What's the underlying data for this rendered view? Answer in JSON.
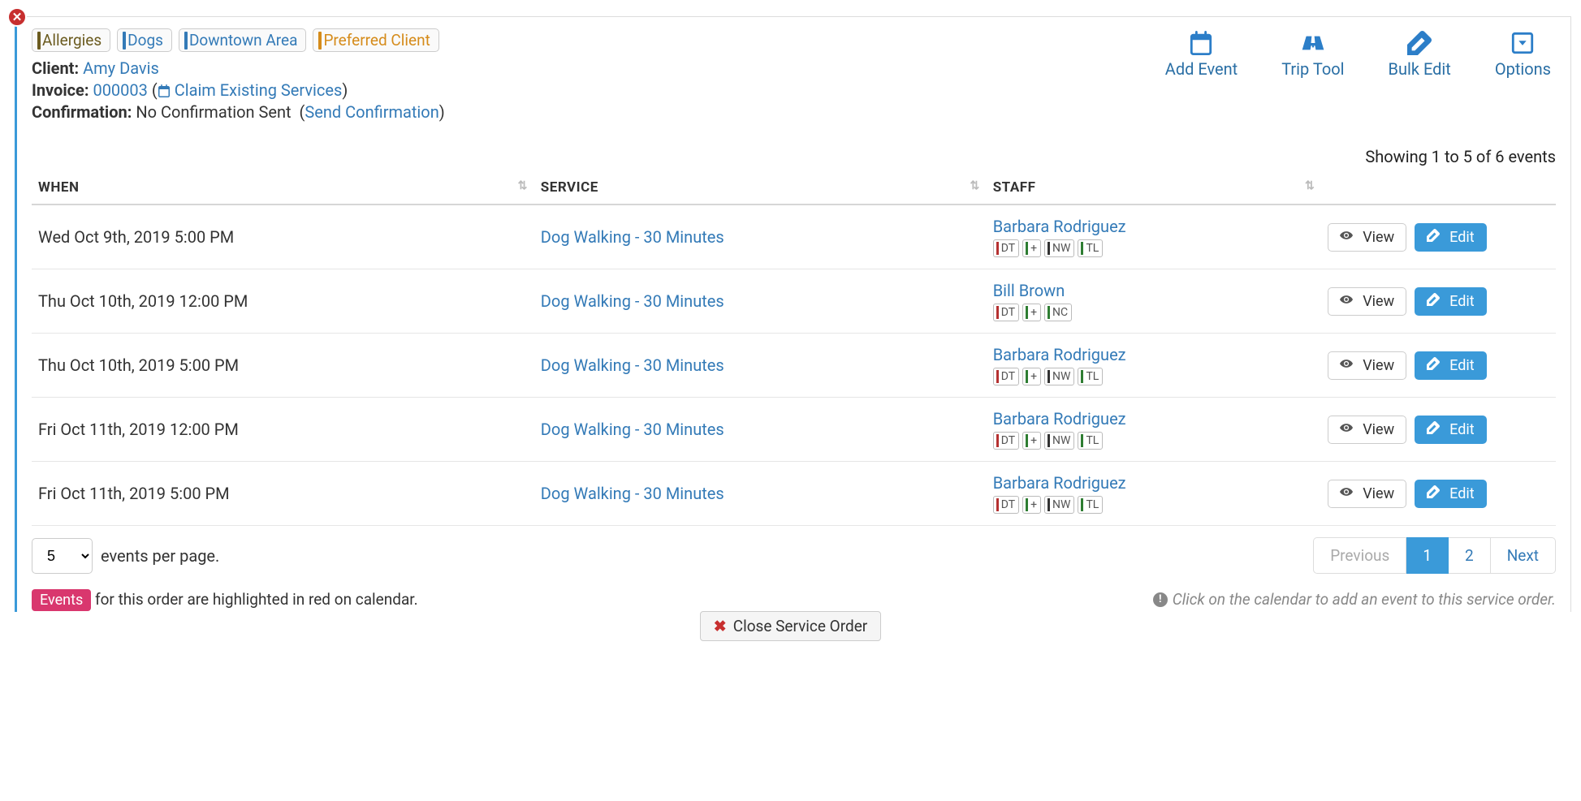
{
  "tags": [
    {
      "label": "Allergies",
      "color": "#6b5b1f"
    },
    {
      "label": "Dogs",
      "color": "#337ab7"
    },
    {
      "label": "Downtown Area",
      "color": "#337ab7"
    },
    {
      "label": "Preferred Client",
      "color": "#d58b1a"
    }
  ],
  "actions": {
    "add_event": "Add Event",
    "trip_tool": "Trip Tool",
    "bulk_edit": "Bulk Edit",
    "options": "Options"
  },
  "info": {
    "client_label": "Client:",
    "client_name": "Amy Davis",
    "invoice_label": "Invoice:",
    "invoice_number": "000003",
    "claim_link": "Claim Existing Services",
    "confirmation_label": "Confirmation:",
    "confirmation_status": "No Confirmation Sent",
    "send_confirmation": "Send Confirmation"
  },
  "showing": "Showing 1 to 5 of 6 events",
  "columns": {
    "when": "WHEN",
    "service": "SERVICE",
    "staff": "STAFF"
  },
  "territories": {
    "DT": {
      "code": "DT",
      "color": "#b53131"
    },
    "PLUS": {
      "code": "+",
      "color": "#2e7d32"
    },
    "NW": {
      "code": "NW",
      "color": "#333"
    },
    "TL": {
      "code": "TL",
      "color": "#2e7d32"
    },
    "NC": {
      "code": "NC",
      "color": "#2e7d32"
    }
  },
  "rows": [
    {
      "when": "Wed Oct 9th, 2019 5:00 PM",
      "service": "Dog Walking - 30 Minutes",
      "staff": "Barbara Rodriguez",
      "terr": [
        "DT",
        "PLUS",
        "NW",
        "TL"
      ]
    },
    {
      "when": "Thu Oct 10th, 2019 12:00 PM",
      "service": "Dog Walking - 30 Minutes",
      "staff": "Bill Brown",
      "terr": [
        "DT",
        "PLUS",
        "NC"
      ]
    },
    {
      "when": "Thu Oct 10th, 2019 5:00 PM",
      "service": "Dog Walking - 30 Minutes",
      "staff": "Barbara Rodriguez",
      "terr": [
        "DT",
        "PLUS",
        "NW",
        "TL"
      ]
    },
    {
      "when": "Fri Oct 11th, 2019 12:00 PM",
      "service": "Dog Walking - 30 Minutes",
      "staff": "Barbara Rodriguez",
      "terr": [
        "DT",
        "PLUS",
        "NW",
        "TL"
      ]
    },
    {
      "when": "Fri Oct 11th, 2019 5:00 PM",
      "service": "Dog Walking - 30 Minutes",
      "staff": "Barbara Rodriguez",
      "terr": [
        "DT",
        "PLUS",
        "NW",
        "TL"
      ]
    }
  ],
  "row_buttons": {
    "view": "View",
    "edit": "Edit"
  },
  "per_page": {
    "value": "5",
    "label": "events per page."
  },
  "pagination": {
    "previous": "Previous",
    "next": "Next",
    "pages": [
      "1",
      "2"
    ],
    "active": "1"
  },
  "footer": {
    "badge": "Events",
    "note": " for this order are highlighted in red on calendar.",
    "hint": "Click on the calendar to add an event to this service order."
  },
  "close_order": "Close Service Order"
}
